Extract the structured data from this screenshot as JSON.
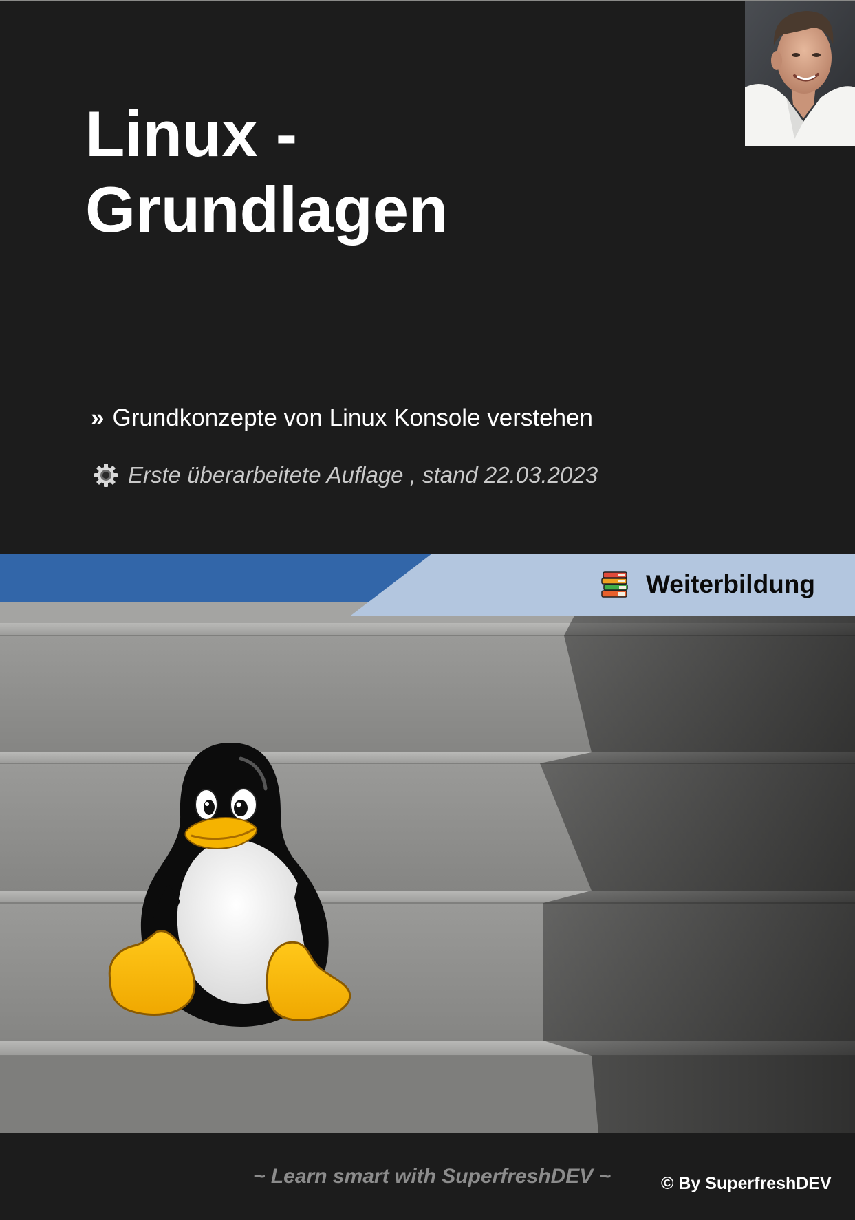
{
  "cover": {
    "title_line1": "Linux -",
    "title_line2": "Grundlagen",
    "subtitle_bullet": "»",
    "subtitle": "Grundkonzepte von Linux Konsole verstehen",
    "edition": "Erste überarbeitete Auflage , stand 22.03.2023",
    "edition_icon": "gear-icon",
    "banner_label": "Weiterbildung",
    "banner_icon": "books-icon",
    "slogan": "~ Learn smart with SuperfreshDEV ~",
    "copyright": "© By SuperfreshDEV"
  },
  "colors": {
    "background": "#1c1c1c",
    "banner_dark_blue": "#3266a9",
    "banner_light_blue": "#b3c6df",
    "text_white": "#ffffff",
    "text_grey": "#c9c9c9",
    "slogan_grey": "#8c8c8c",
    "tux_yellow": "#f5b300"
  }
}
